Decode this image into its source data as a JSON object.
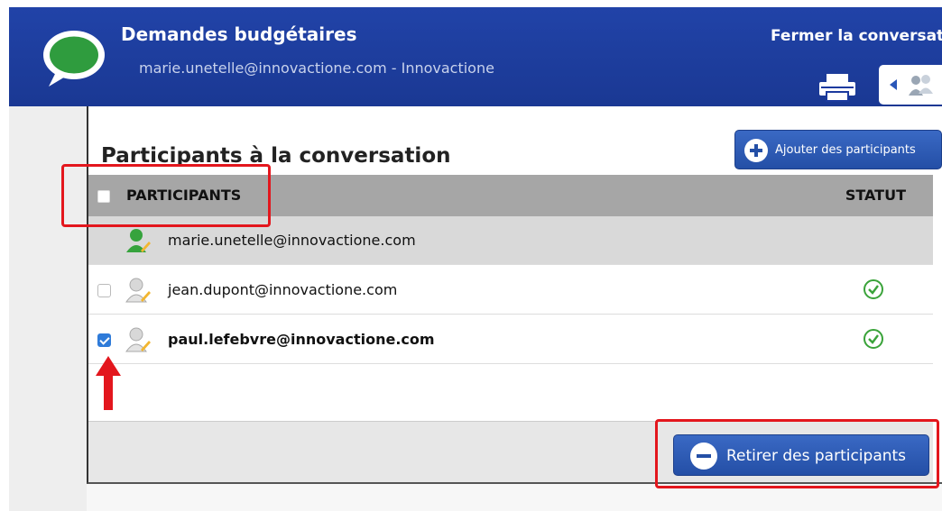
{
  "header": {
    "title": "Demandes budgétaires",
    "subtitle": "marie.unetelle@innovactione.com - Innovactione",
    "close_label": "Fermer la conversation",
    "icons": [
      "chat-bubble-icon",
      "printer-icon",
      "participants-icon"
    ]
  },
  "panel": {
    "title": "Participants à la conversation",
    "add_button": "Ajouter des participants",
    "remove_button": "Retirer des participants",
    "columns": {
      "participants": "PARTICIPANTS",
      "status": "STATUT"
    },
    "rows": [
      {
        "email": "marie.unetelle@innovactione.com",
        "owner": true,
        "checked": false,
        "status": ""
      },
      {
        "email": "jean.dupont@innovactione.com",
        "owner": false,
        "checked": false,
        "status": "ok"
      },
      {
        "email": "paul.lefebvre@innovactione.com",
        "owner": false,
        "checked": true,
        "status": "ok"
      }
    ]
  },
  "colors": {
    "header_bg": "#1f3fa3",
    "button_bg": "#2d5bb8",
    "annotation": "#e3161d",
    "status_ok": "#3aa33a"
  }
}
